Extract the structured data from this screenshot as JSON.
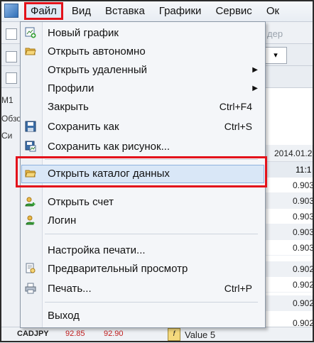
{
  "menubar": {
    "items": [
      {
        "label": "Файл",
        "active": true
      },
      {
        "label": "Вид"
      },
      {
        "label": "Вставка"
      },
      {
        "label": "Графики"
      },
      {
        "label": "Сервис"
      },
      {
        "label": "Ок"
      }
    ]
  },
  "toolbar": {
    "faded_label": "дер",
    "stub": "▾",
    "left_labels": [
      "M1",
      "Обзо",
      "Си"
    ]
  },
  "file_menu": {
    "items": [
      {
        "label": "Новый график",
        "icon": "new-chart-icon"
      },
      {
        "label": "Открыть автономно",
        "icon": "folder-open-icon"
      },
      {
        "label": "Открыть удаленный",
        "submenu": true
      },
      {
        "label": "Профили",
        "submenu": true
      },
      {
        "label": "Закрыть",
        "shortcut": "Ctrl+F4"
      },
      {
        "label": "Сохранить как",
        "shortcut": "Ctrl+S",
        "icon": "save-icon"
      },
      {
        "label": "Сохранить как рисунок...",
        "icon": "save-image-icon"
      },
      {
        "label": "Открыть каталог данных",
        "icon": "folder-icon",
        "highlighted": true
      },
      {
        "label": "Открыть счет",
        "icon": "add-account-icon"
      },
      {
        "label": "Логин",
        "icon": "login-icon"
      },
      {
        "label": "Настройка печати..."
      },
      {
        "label": "Предварительный просмотр",
        "icon": "print-preview-icon"
      },
      {
        "label": "Печать...",
        "shortcut": "Ctrl+P",
        "icon": "printer-icon"
      },
      {
        "label": "Выход"
      }
    ],
    "submenu_arrow": "▶"
  },
  "right_panel": {
    "date": "2014.01.2",
    "time": "11:1",
    "values": [
      "0.903",
      "0.903",
      "0.903",
      "0.903",
      "0.903",
      "0.902",
      "0.902",
      "0.902",
      "0.902"
    ]
  },
  "quotes_row": {
    "symbol": "CADJPY",
    "bid": "92.85",
    "ask": "92.90"
  },
  "indicator_tab": {
    "label": "Value 5",
    "icon_text": "f"
  },
  "colors": {
    "highlight_border": "#e3121b",
    "menu_hover": "#d9e7f7"
  }
}
